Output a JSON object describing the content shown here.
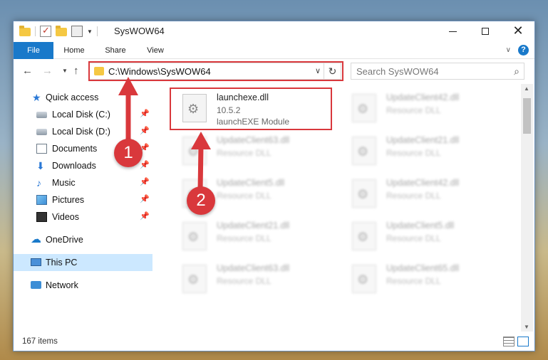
{
  "window": {
    "title": "SysWOW64"
  },
  "ribbon": {
    "tabs": [
      "File",
      "Home",
      "Share",
      "View"
    ]
  },
  "address": {
    "path": "C:\\Windows\\SysWOW64",
    "search_placeholder": "Search SysWOW64"
  },
  "sidebar": {
    "items": [
      {
        "label": "Quick access",
        "icon": "star-icon"
      },
      {
        "label": "Local Disk (C:)",
        "icon": "drive-icon",
        "pinned": true
      },
      {
        "label": "Local Disk (D:)",
        "icon": "drive-icon",
        "pinned": true
      },
      {
        "label": "Documents",
        "icon": "documents-icon",
        "pinned": true
      },
      {
        "label": "Downloads",
        "icon": "downloads-icon",
        "pinned": true
      },
      {
        "label": "Music",
        "icon": "music-icon",
        "pinned": true
      },
      {
        "label": "Pictures",
        "icon": "pictures-icon",
        "pinned": true
      },
      {
        "label": "Videos",
        "icon": "videos-icon",
        "pinned": true
      },
      {
        "label": "OneDrive",
        "icon": "cloud-icon"
      },
      {
        "label": "This PC",
        "icon": "computer-icon",
        "selected": true
      },
      {
        "label": "Network",
        "icon": "network-icon"
      }
    ]
  },
  "files": {
    "highlighted": {
      "name": "launchexe.dll",
      "version": "10.5.2",
      "description": "launchEXE Module"
    },
    "left_column": [
      {
        "name": "UpdateClient63.dll",
        "type": "Resource DLL"
      },
      {
        "name": "UpdateClient5.dll",
        "type": "Resource DLL"
      },
      {
        "name": "UpdateClient21.dll",
        "type": "Resource DLL"
      },
      {
        "name": "UpdateClient63.dll",
        "type": "Resource DLL"
      }
    ],
    "right_column": [
      {
        "name": "UpdateClient42.dll",
        "type": "Resource DLL"
      },
      {
        "name": "UpdateClient21.dll",
        "type": "Resource DLL"
      },
      {
        "name": "UpdateClient42.dll",
        "type": "Resource DLL"
      },
      {
        "name": "UpdateClient5.dll",
        "type": "Resource DLL"
      },
      {
        "name": "UpdateClient65.dll",
        "type": "Resource DLL"
      }
    ]
  },
  "status": {
    "item_count": "167 items"
  },
  "annotations": {
    "badge1": "1",
    "badge2": "2",
    "color": "#d9383c"
  }
}
